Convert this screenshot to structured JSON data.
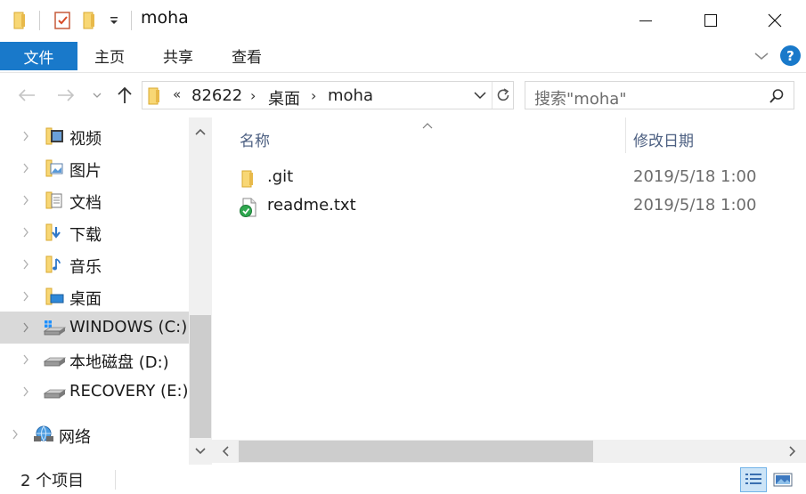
{
  "window": {
    "title": "moha",
    "quick_access_icons": [
      "folder-icon",
      "properties-icon",
      "new-folder-icon",
      "customize-dropdown-icon"
    ],
    "controls": [
      "minimize-icon",
      "maximize-icon",
      "close-icon"
    ]
  },
  "ribbon": {
    "tabs": [
      {
        "label": "文件",
        "active": true
      },
      {
        "label": "主页"
      },
      {
        "label": "共享"
      },
      {
        "label": "查看"
      }
    ],
    "help": "?"
  },
  "address": {
    "overflow": "«",
    "crumbs": [
      "82622",
      "桌面",
      "moha"
    ],
    "separator": "›"
  },
  "search": {
    "placeholder": "搜索\"moha\""
  },
  "nav_pane": {
    "items": [
      {
        "label": "视频",
        "icon": "videos-folder-icon"
      },
      {
        "label": "图片",
        "icon": "pictures-folder-icon"
      },
      {
        "label": "文档",
        "icon": "documents-folder-icon"
      },
      {
        "label": "下载",
        "icon": "downloads-folder-icon"
      },
      {
        "label": "音乐",
        "icon": "music-folder-icon"
      },
      {
        "label": "桌面",
        "icon": "desktop-folder-icon"
      },
      {
        "label": "WINDOWS (C:)",
        "icon": "windows-drive-icon",
        "selected": true
      },
      {
        "label": "本地磁盘 (D:)",
        "icon": "drive-icon"
      },
      {
        "label": "RECOVERY (E:)",
        "icon": "drive-icon"
      },
      {
        "label": "网络",
        "icon": "network-icon"
      }
    ]
  },
  "file_list": {
    "columns": {
      "name": "名称",
      "modified": "修改日期"
    },
    "files": [
      {
        "name": ".git",
        "modified": "2019/5/18 1:00",
        "icon": "folder-icon"
      },
      {
        "name": "readme.txt",
        "modified": "2019/5/18 1:00",
        "icon": "text-file-synced-icon"
      }
    ]
  },
  "status": {
    "count": "2 个项目"
  },
  "colors": {
    "accent": "#1979ca",
    "selection": "#d9d9d9",
    "column_header": "#4d6082",
    "folder": "#f8d775"
  }
}
